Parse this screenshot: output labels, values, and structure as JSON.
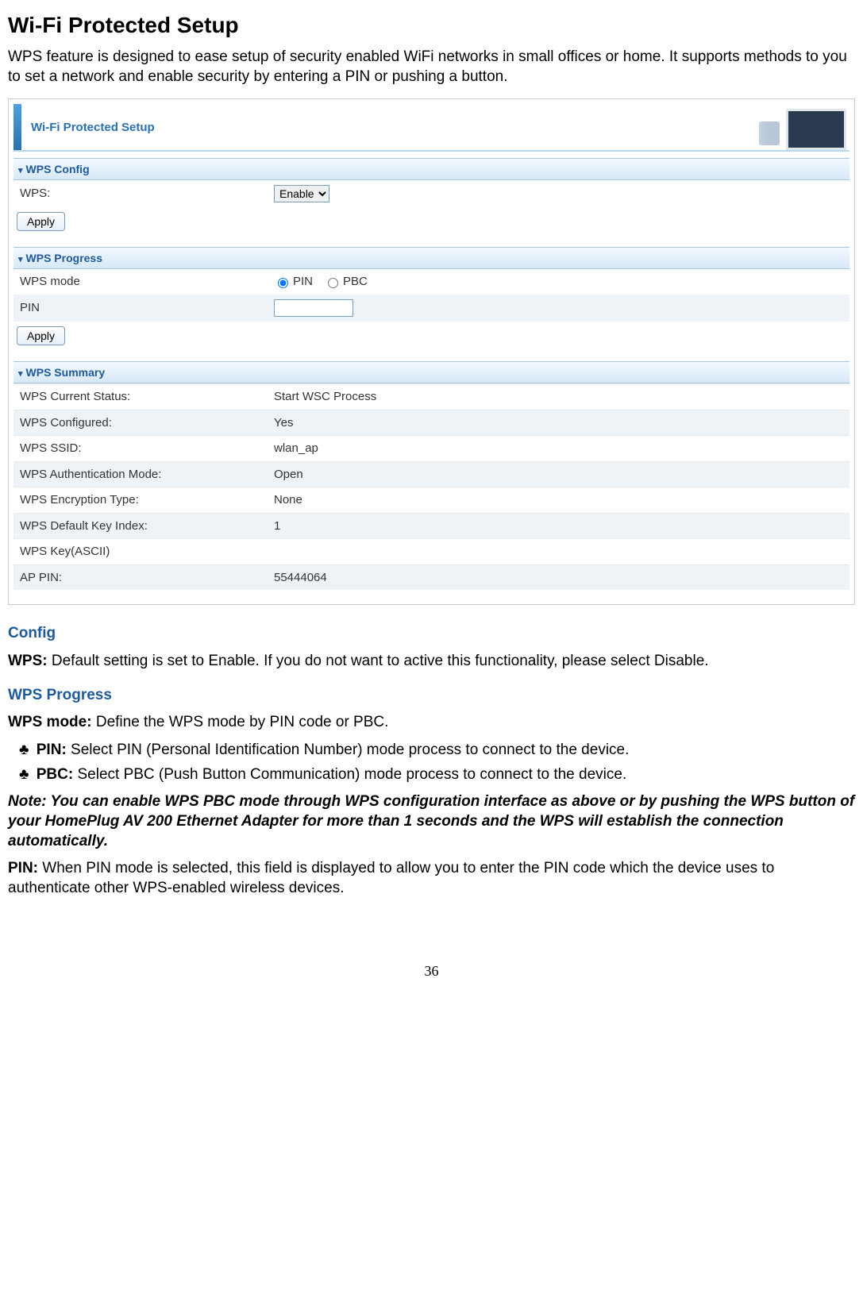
{
  "page_title": "Wi-Fi Protected Setup",
  "intro": "WPS feature is designed to ease setup of security enabled WiFi networks in small offices or home. It supports methods to you to set a network and enable security by entering a PIN or pushing a button.",
  "banner_title": "Wi-Fi Protected Setup",
  "sections": {
    "config": {
      "head": "WPS Config",
      "wps_label": "WPS:",
      "wps_value": "Enable",
      "apply": "Apply"
    },
    "progress": {
      "head": "WPS Progress",
      "mode_label": "WPS mode",
      "mode_pin": "PIN",
      "mode_pbc": "PBC",
      "pin_label": "PIN",
      "pin_value": "",
      "apply": "Apply"
    },
    "summary": {
      "head": "WPS Summary",
      "rows": {
        "r0": {
          "label": "WPS Current Status:",
          "value": "Start WSC Process"
        },
        "r1": {
          "label": "WPS Configured:",
          "value": "Yes"
        },
        "r2": {
          "label": "WPS SSID:",
          "value": "wlan_ap"
        },
        "r3": {
          "label": "WPS Authentication Mode:",
          "value": "Open"
        },
        "r4": {
          "label": "WPS Encryption Type:",
          "value": "None"
        },
        "r5": {
          "label": "WPS Default Key Index:",
          "value": "1"
        },
        "r6": {
          "label": "WPS Key(ASCII)",
          "value": ""
        },
        "r7": {
          "label": "AP PIN:",
          "value": "55444064"
        }
      }
    }
  },
  "describe": {
    "config_head": "Config",
    "wps_lead": "WPS:",
    "wps_text": " Default setting is set to Enable. If you do not want to active this functionality, please select Disable.",
    "progress_head": "WPS Progress",
    "mode_lead": "WPS mode:",
    "mode_text": " Define the WPS mode by PIN code or PBC.",
    "pin_lead": "PIN:",
    "pin_text": " Select PIN (Personal Identification Number) mode process to connect to the device.",
    "pbc_lead": "PBC:",
    "pbc_text": " Select PBC (Push Button Communication) mode process to connect to the device.",
    "note": "Note: You can enable WPS PBC mode through WPS configuration interface as above or by pushing the WPS button of your HomePlug AV 200 Ethernet Adapter for more than 1 seconds and the WPS will establish the connection automatically.",
    "pin2_lead": "PIN:",
    "pin2_text": " When PIN mode is selected, this field is displayed to allow you to enter the PIN code which the device uses to authenticate other WPS-enabled wireless devices."
  },
  "page_number": "36"
}
